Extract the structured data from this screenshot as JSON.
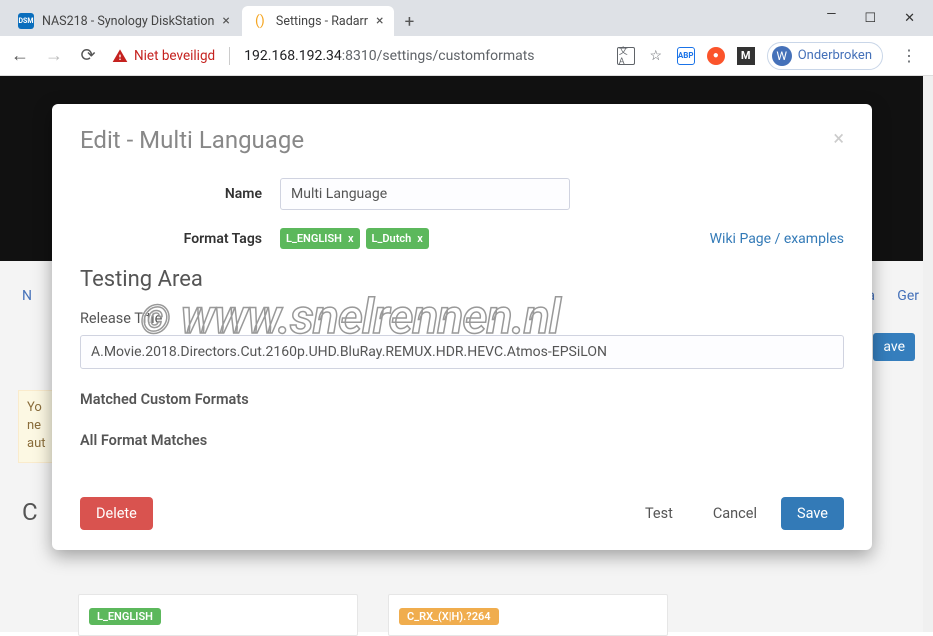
{
  "window": {
    "tabs": [
      {
        "title": "NAS218 - Synology DiskStation",
        "favicon": "DSM"
      },
      {
        "title": "Settings - Radarr",
        "favicon": "()"
      }
    ]
  },
  "address": {
    "secure_label": "Niet beveiligd",
    "host": "192.168.192.34",
    "port": ":8310",
    "path": "/settings/customformats",
    "profile_name": "Onderbroken",
    "profile_initial": "W"
  },
  "background": {
    "nav_partial_left": "N",
    "nav_partial_right1": "ta",
    "nav_partial_right2": "Ger",
    "save_btn": "ave",
    "warn_l1": "Yo",
    "warn_l2": "ne",
    "warn_l3": "aut",
    "heading_c": "C",
    "card1_title_fragment": "",
    "card1_tag": "L_ENGLISH",
    "card2_tag": "C_RX_(X|H).?264"
  },
  "modal": {
    "title": "Edit - Multi Language",
    "name_label": "Name",
    "name_value": "Multi Language",
    "tags_label": "Format Tags",
    "tags": [
      "L_ENGLISH",
      "L_Dutch"
    ],
    "help_link": "Wiki Page / examples",
    "testing_title": "Testing Area",
    "release_label": "Release Title",
    "release_value": "A.Movie.2018.Directors.Cut.2160p.UHD.BluRay.REMUX.HDR.HEVC.Atmos-EPSiLON",
    "matched_label": "Matched Custom Formats",
    "all_matches_label": "All Format Matches",
    "delete": "Delete",
    "test": "Test",
    "cancel": "Cancel",
    "save": "Save"
  },
  "watermark": "www.snelrennen.nl"
}
